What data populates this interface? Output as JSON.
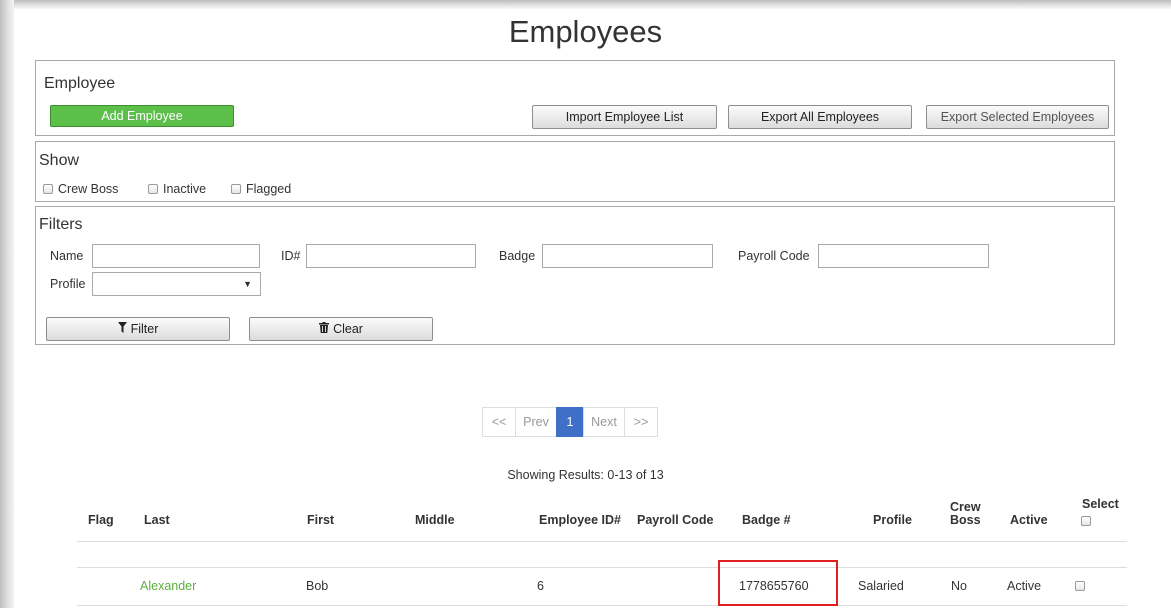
{
  "page": {
    "title": "Employees"
  },
  "employee_panel": {
    "title": "Employee",
    "add_label": "Add Employee",
    "import_label": "Import Employee List",
    "export_all_label": "Export All Employees",
    "export_selected_label": "Export Selected Employees"
  },
  "show_panel": {
    "title": "Show",
    "options": [
      {
        "label": "Crew Boss",
        "checked": false
      },
      {
        "label": "Inactive",
        "checked": false
      },
      {
        "label": "Flagged",
        "checked": false
      }
    ]
  },
  "filters": {
    "title": "Filters",
    "name_label": "Name",
    "id_label": "ID#",
    "badge_label": "Badge",
    "payroll_label": "Payroll Code",
    "profile_label": "Profile",
    "profile_value": "",
    "name_value": "",
    "id_value": "",
    "badge_value": "",
    "payroll_value": "",
    "filter_label": "Filter",
    "clear_label": "Clear",
    "filter_icon": "funnel-icon",
    "clear_icon": "trash-icon"
  },
  "pagination": {
    "first": "<<",
    "prev": "Prev",
    "current": "1",
    "next": "Next",
    "last": ">>"
  },
  "results_text": "Showing Results: 0-13 of 13",
  "table": {
    "headers": {
      "flag": "Flag",
      "last": "Last",
      "first": "First",
      "middle": "Middle",
      "employee_id": "Employee ID#",
      "payroll_code": "Payroll Code",
      "badge": "Badge #",
      "profile": "Profile",
      "crew_boss_1": "Crew",
      "crew_boss_2": "Boss",
      "active": "Active",
      "select": "Select"
    },
    "rows": [
      {
        "flag": "",
        "last": "Alexander",
        "first": "Bob",
        "middle": "",
        "employee_id": "6",
        "payroll_code": "",
        "badge": "1778655760",
        "profile": "Salaried",
        "crew_boss": "No",
        "active": "Active",
        "selected": false
      }
    ]
  },
  "colors": {
    "accent_green": "#5cbf4a",
    "link_green": "#5cae3f",
    "pager_active": "#3f6fc6",
    "highlight_red": "#e02020"
  }
}
